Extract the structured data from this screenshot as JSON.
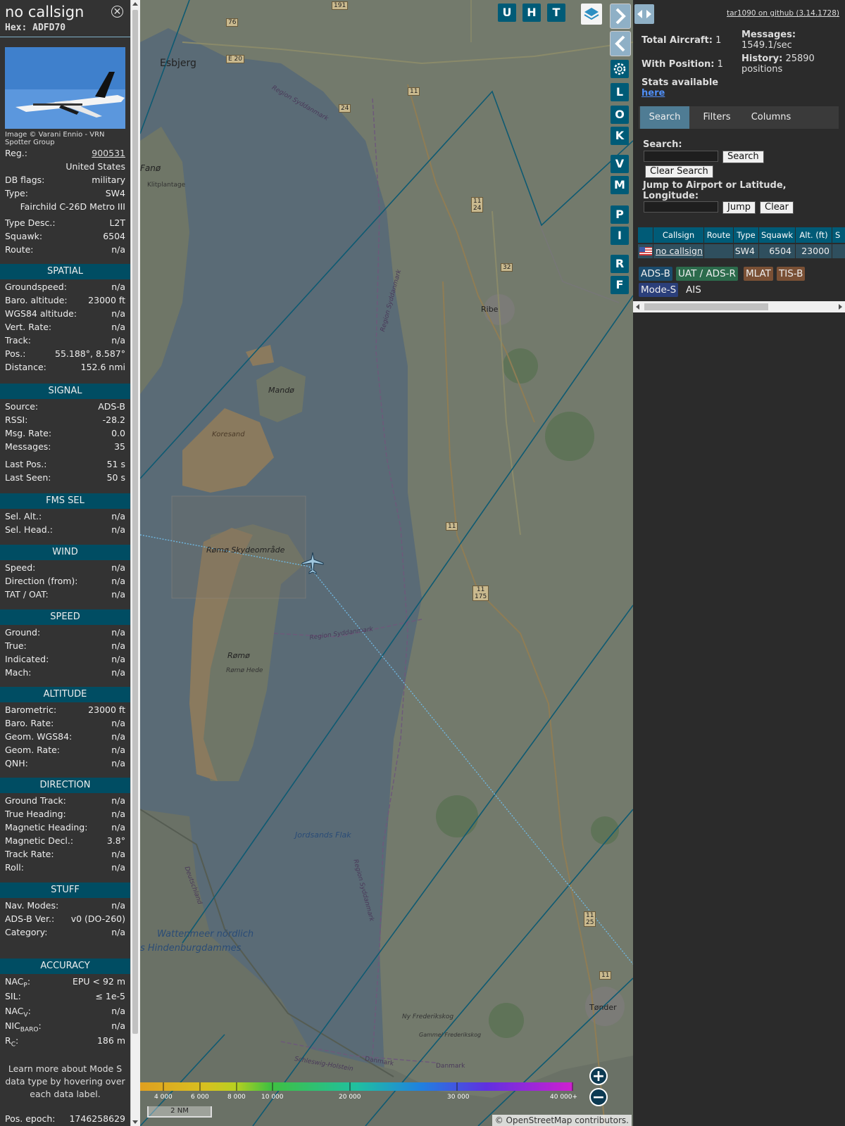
{
  "info": {
    "callsign": "no callsign",
    "hex": "Hex: ADFD70",
    "photo_credit": "Image © Varani Ennio - VRN Spotter Group",
    "reg_label": "Reg.:",
    "reg_value": "900531",
    "country": "United States",
    "dbflags_label": "DB flags:",
    "dbflags_value": "military",
    "type_label": "Type:",
    "type_value": "SW4",
    "type_full": "Fairchild C-26D Metro III",
    "typedesc_label": "Type Desc.:",
    "typedesc_value": "L2T",
    "squawk_label": "Squawk:",
    "squawk_value": "6504",
    "route_label": "Route:",
    "route_value": "n/a",
    "sections": {
      "spatial": "SPATIAL",
      "signal": "SIGNAL",
      "fms": "FMS SEL",
      "wind": "WIND",
      "speed": "SPEED",
      "altitude": "ALTITUDE",
      "direction": "DIRECTION",
      "stuff": "STUFF",
      "accuracy": "ACCURACY"
    },
    "spatial": [
      {
        "label": "Groundspeed:",
        "value": "n/a"
      },
      {
        "label": "Baro. altitude:",
        "value": "23000 ft"
      },
      {
        "label": "WGS84 altitude:",
        "value": "n/a"
      },
      {
        "label": "Vert. Rate:",
        "value": "n/a"
      },
      {
        "label": "Track:",
        "value": "n/a"
      },
      {
        "label": "Pos.:",
        "value": "55.188°, 8.587°"
      },
      {
        "label": "Distance:",
        "value": "152.6 nmi"
      }
    ],
    "signal": [
      {
        "label": "Source:",
        "value": "ADS-B"
      },
      {
        "label": "RSSI:",
        "value": "-28.2"
      },
      {
        "label": "Msg. Rate:",
        "value": "0.0"
      },
      {
        "label": "Messages:",
        "value": "35"
      },
      {
        "label": "Last Pos.:",
        "value": "51 s"
      },
      {
        "label": "Last Seen:",
        "value": "50 s"
      }
    ],
    "fms": [
      {
        "label": "Sel. Alt.:",
        "value": "n/a"
      },
      {
        "label": "Sel. Head.:",
        "value": "n/a"
      }
    ],
    "wind": [
      {
        "label": "Speed:",
        "value": "n/a"
      },
      {
        "label": "Direction (from):",
        "value": "n/a"
      },
      {
        "label": "TAT / OAT:",
        "value": "n/a"
      }
    ],
    "speed": [
      {
        "label": "Ground:",
        "value": "n/a"
      },
      {
        "label": "True:",
        "value": "n/a"
      },
      {
        "label": "Indicated:",
        "value": "n/a"
      },
      {
        "label": "Mach:",
        "value": "n/a"
      }
    ],
    "altitude": [
      {
        "label": "Barometric:",
        "value": "23000 ft"
      },
      {
        "label": "Baro. Rate:",
        "value": "n/a"
      },
      {
        "label": "Geom. WGS84:",
        "value": "n/a"
      },
      {
        "label": "Geom. Rate:",
        "value": "n/a"
      },
      {
        "label": "QNH:",
        "value": "n/a"
      }
    ],
    "direction": [
      {
        "label": "Ground Track:",
        "value": "n/a"
      },
      {
        "label": "True Heading:",
        "value": "n/a"
      },
      {
        "label": "Magnetic Heading:",
        "value": "n/a"
      },
      {
        "label": "Magnetic Decl.:",
        "value": "3.8°"
      },
      {
        "label": "Track Rate:",
        "value": "n/a"
      },
      {
        "label": "Roll:",
        "value": "n/a"
      }
    ],
    "stuff": [
      {
        "label": "Nav. Modes:",
        "value": "n/a"
      },
      {
        "label": "ADS-B Ver.:",
        "value": "v0 (DO-260)"
      },
      {
        "label": "Category:",
        "value": "n/a"
      }
    ],
    "accuracy": [
      {
        "label": "NACP:",
        "value": "EPU < 92 m"
      },
      {
        "label": "SIL:",
        "value": "≤ 1e-5"
      },
      {
        "label": "NACV:",
        "value": "n/a"
      },
      {
        "label": "NICBARO:",
        "value": "n/a"
      },
      {
        "label": "RC:",
        "value": "186 m"
      }
    ],
    "learn_more": "Learn more about Mode S data type by hovering over each data label.",
    "pos_epoch_label": "Pos. epoch:",
    "pos_epoch_value": "1746258629"
  },
  "map": {
    "place_labels": [
      "Esbjerg",
      "Fanø",
      "Klitplantage",
      "Mandø",
      "Koresand",
      "Rømø Skydeområde",
      "Rømø",
      "Rømø Hede",
      "Ribe",
      "Jordsands Flak",
      "Wattenmeer nördlich",
      "s Hindenburgdammes",
      "Ny Frederikskog",
      "Gammel Frederikskog",
      "Tønder",
      "Region Syddanmark",
      "Region Syddanmark",
      "Region Syddanmark",
      "Region Syddanmark",
      "Danmark",
      "Deutschland",
      "Schleswig-Holstein",
      "Danmark"
    ],
    "road_labels": [
      "191",
      "76",
      "E 20",
      "24",
      "11",
      "11\n24",
      "32",
      "11",
      "11\n175",
      "11\n25",
      "11"
    ],
    "buttons": [
      "U",
      "H",
      "T"
    ],
    "side_buttons": [
      "L",
      "O",
      "K",
      "V",
      "M",
      "P",
      "I",
      "R",
      "F"
    ],
    "legend_labels": [
      "4 000",
      "6 000",
      "8 000",
      "10 000",
      "20 000",
      "30 000",
      "40 000+"
    ],
    "scale": "2 NM",
    "attribution_prefix": "© ",
    "attribution_link": "OpenStreetMap",
    "attribution_suffix": " contributors."
  },
  "sidebar": {
    "github_link": "tar1090 on github (3.14.1728)",
    "total_label": "Total Aircraft:",
    "total_value": "1",
    "withpos_label": "With Position:",
    "withpos_value": "1",
    "stats_label": "Stats available",
    "stats_link": "here",
    "messages_label": "Messages:",
    "messages_value": "1549.1/sec",
    "history_label": "History:",
    "history_value": "25890 positions",
    "tabs": [
      "Search",
      "Filters",
      "Columns"
    ],
    "search_label": "Search:",
    "search_button": "Search",
    "clear_search_button": "Clear Search",
    "jump_label": "Jump to Airport or Latitude, Longitude:",
    "jump_button": "Jump",
    "clear_button": "Clear",
    "table_headers": [
      "",
      "Callsign",
      "Route",
      "Type",
      "Squawk",
      "Alt. (ft)",
      "S"
    ],
    "table_row": {
      "callsign": "no callsign",
      "route": "",
      "type": "SW4",
      "squawk": "6504",
      "alt": "23000"
    },
    "sources": [
      "ADS-B",
      "UAT / ADS-R",
      "MLAT",
      "TIS-B",
      "Mode-S",
      "AIS"
    ]
  },
  "colors": {
    "accent": "#004d63",
    "button": "#005b77",
    "adsb": "#1b4b6c",
    "uat": "#2c6b4c",
    "mlat": "#7a5035",
    "tisb": "#7a5035",
    "modes": "#2b3f7a"
  }
}
